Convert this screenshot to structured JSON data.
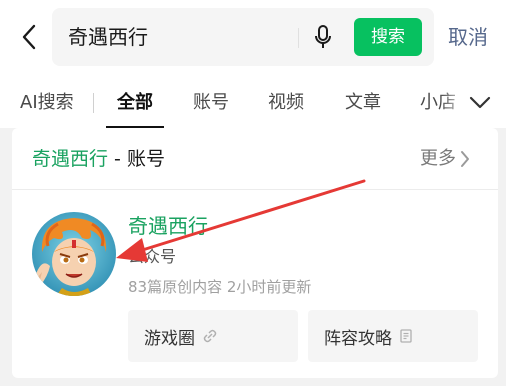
{
  "search": {
    "query": "奇遇西行",
    "button_label": "搜索",
    "cancel_label": "取消"
  },
  "tabs": [
    {
      "label": "AI搜索",
      "active": false
    },
    {
      "label": "全部",
      "active": true
    },
    {
      "label": "账号",
      "active": false
    },
    {
      "label": "视频",
      "active": false
    },
    {
      "label": "文章",
      "active": false
    },
    {
      "label": "小店",
      "active": false
    }
  ],
  "card": {
    "title_name": "奇遇西行",
    "title_suffix": " - 账号",
    "more_label": "更多"
  },
  "result": {
    "name": "奇遇西行",
    "type": "公众号",
    "meta": "83篇原创内容  2小时前更新",
    "chips": [
      {
        "label": "游戏圈",
        "icon": "link-icon"
      },
      {
        "label": "阵容攻略",
        "icon": "article-icon"
      }
    ]
  },
  "colors": {
    "accent_green": "#07c160",
    "name_green": "#1aa260",
    "cancel_blue": "#56688c",
    "annotation_red": "#e53935"
  }
}
